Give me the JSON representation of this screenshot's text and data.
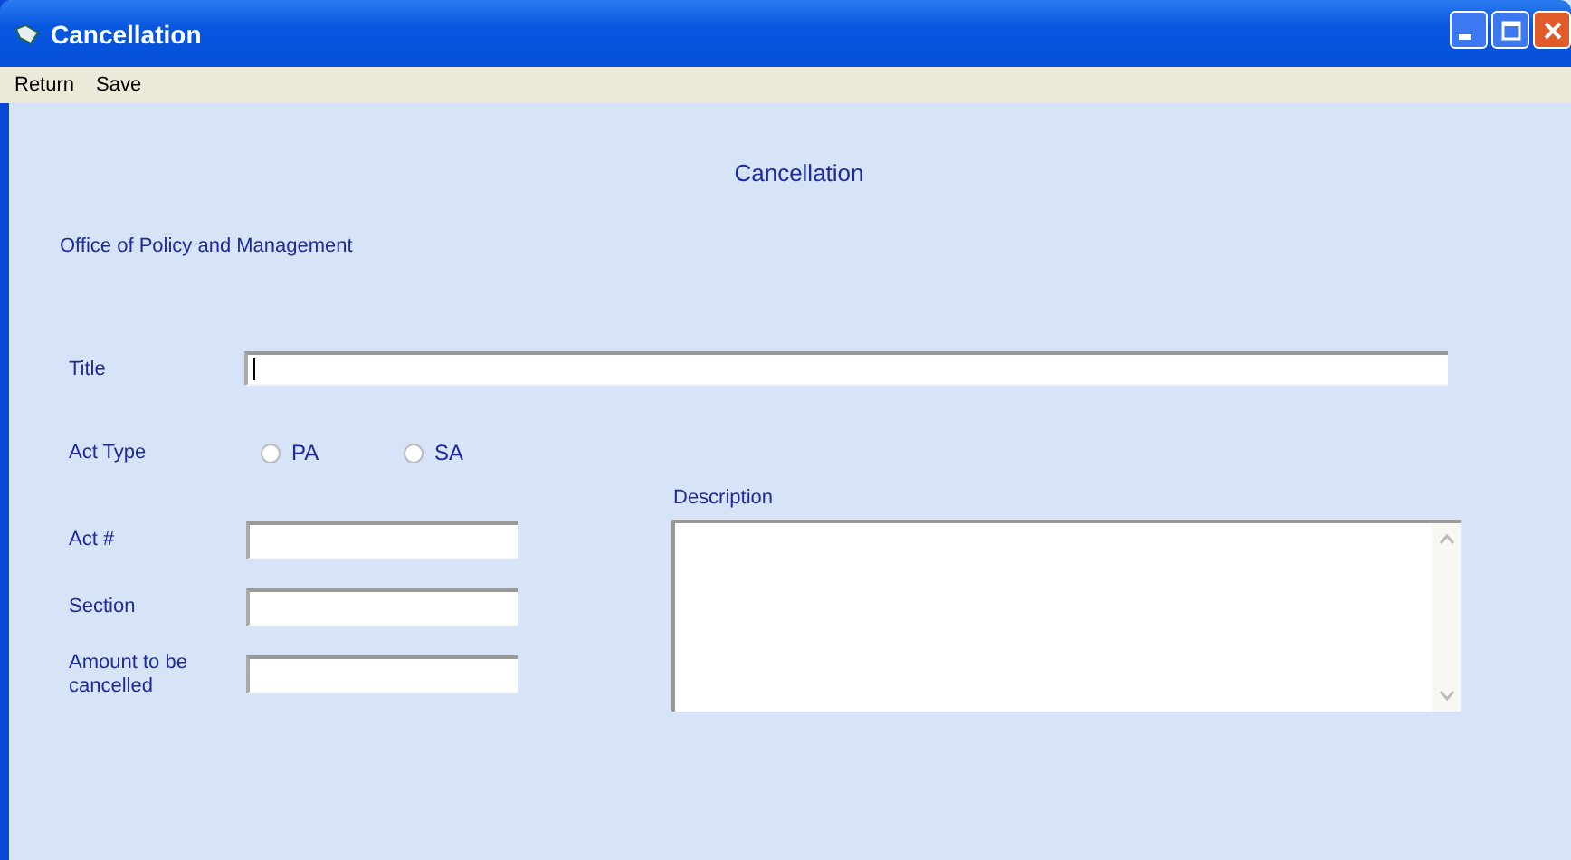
{
  "window": {
    "title": "Cancellation"
  },
  "menu": [
    "Return",
    "Save"
  ],
  "heading": "Cancellation",
  "organization": "Office of Policy and Management",
  "title_field": {
    "label": "Title"
  },
  "act_type": {
    "label": "Act Type",
    "options": [
      {
        "label": "PA",
        "selected": false
      },
      {
        "label": "SA",
        "selected": false
      }
    ]
  },
  "fields": [
    {
      "label": "Act #"
    },
    {
      "label": "Section"
    },
    {
      "label": "Amount to be cancelled"
    }
  ],
  "description": {
    "label": "Description"
  }
}
